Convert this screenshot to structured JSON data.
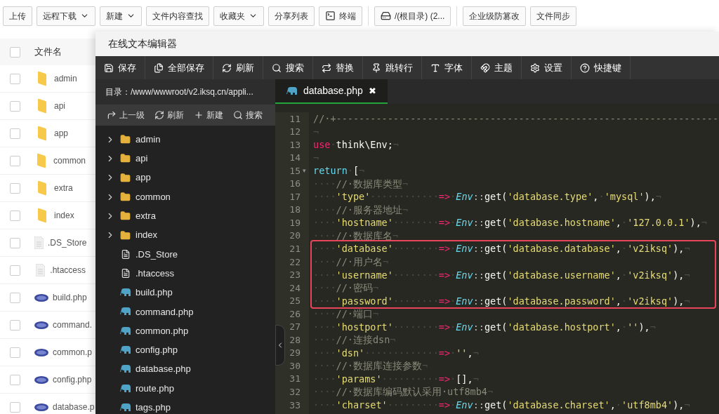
{
  "toolbar": [
    {
      "label": "上传",
      "kind": "plain"
    },
    {
      "label": "远程下载",
      "kind": "dropdown"
    },
    {
      "label": "新建",
      "kind": "dropdown"
    },
    {
      "label": "文件内容查找",
      "kind": "plain"
    },
    {
      "label": "收藏夹",
      "kind": "dropdown"
    },
    {
      "label": "分享列表",
      "kind": "plain"
    },
    {
      "label": "终端",
      "kind": "terminal"
    },
    {
      "label": "/(根目录) (2...",
      "kind": "drive"
    },
    {
      "label": "企业级防篡改",
      "kind": "plain"
    },
    {
      "label": "文件同步",
      "kind": "plain"
    }
  ],
  "file_list": {
    "header": "文件名",
    "header_checked": false,
    "rows": [
      {
        "name": "admin",
        "kind": "folder",
        "checked": false
      },
      {
        "name": "api",
        "kind": "folder",
        "checked": false
      },
      {
        "name": "app",
        "kind": "folder",
        "checked": false
      },
      {
        "name": "common",
        "kind": "folder",
        "checked": false
      },
      {
        "name": "extra",
        "kind": "folder",
        "checked": false
      },
      {
        "name": "index",
        "kind": "folder",
        "checked": false
      },
      {
        "name": ".DS_Store",
        "kind": "file",
        "checked": false
      },
      {
        "name": ".htaccess",
        "kind": "file",
        "checked": false
      },
      {
        "name": "build.php",
        "kind": "php",
        "checked": false
      },
      {
        "name": "command.",
        "kind": "php",
        "checked": false
      },
      {
        "name": "common.p",
        "kind": "php",
        "checked": false
      },
      {
        "name": "config.php",
        "kind": "php",
        "checked": false
      },
      {
        "name": "database.p",
        "kind": "php",
        "checked": false
      }
    ]
  },
  "editor": {
    "title": "在线文本编辑器",
    "toolbar": [
      {
        "label": "保存"
      },
      {
        "label": "全部保存"
      },
      {
        "label": "刷新"
      },
      {
        "label": "搜索"
      },
      {
        "label": "替换"
      },
      {
        "label": "跳转行"
      },
      {
        "label": "字体"
      },
      {
        "label": "主题"
      },
      {
        "label": "设置"
      },
      {
        "label": "快捷键"
      }
    ],
    "path": "目录：/www/wwwroot/v2.iksq.cn/appli...",
    "actions": [
      {
        "label": "上一级"
      },
      {
        "label": "刷新"
      },
      {
        "label": "新建"
      },
      {
        "label": "搜索"
      }
    ],
    "tree": [
      {
        "name": "admin",
        "kind": "folder",
        "expanded": false
      },
      {
        "name": "api",
        "kind": "folder",
        "expanded": false
      },
      {
        "name": "app",
        "kind": "folder",
        "expanded": false
      },
      {
        "name": "common",
        "kind": "folder",
        "expanded": false
      },
      {
        "name": "extra",
        "kind": "folder",
        "expanded": false
      },
      {
        "name": "index",
        "kind": "folder",
        "expanded": false
      },
      {
        "name": ".DS_Store",
        "kind": "file"
      },
      {
        "name": ".htaccess",
        "kind": "file"
      },
      {
        "name": "build.php",
        "kind": "php"
      },
      {
        "name": "command.php",
        "kind": "php"
      },
      {
        "name": "common.php",
        "kind": "php"
      },
      {
        "name": "config.php",
        "kind": "php"
      },
      {
        "name": "database.php",
        "kind": "php"
      },
      {
        "name": "route.php",
        "kind": "php"
      },
      {
        "name": "tags.php",
        "kind": "php"
      }
    ],
    "tabs": [
      {
        "label": "database.php",
        "selected": true,
        "close": "✖"
      }
    ],
    "code": [
      {
        "num": "11",
        "tokens": [
          {
            "kind": "comment",
            "text": "//·+-------------------------------------------------------------------"
          }
        ]
      },
      {
        "num": "12",
        "tokens": [
          {
            "kind": "eol",
            "text": "¬"
          }
        ]
      },
      {
        "num": "13",
        "tokens": [
          {
            "kind": "kw",
            "text": "use"
          },
          {
            "kind": "ws",
            "text": "·"
          },
          {
            "kind": "plain",
            "text": "think\\Env;"
          },
          {
            "kind": "eol",
            "text": "¬"
          }
        ]
      },
      {
        "num": "14",
        "tokens": [
          {
            "kind": "eol",
            "text": "¬"
          }
        ]
      },
      {
        "num": "15",
        "fold": "▾",
        "tokens": [
          {
            "kind": "kw2",
            "text": "return"
          },
          {
            "kind": "ws",
            "text": "·"
          },
          {
            "kind": "plain",
            "text": "["
          },
          {
            "kind": "eol",
            "text": "¬"
          }
        ]
      },
      {
        "num": "16",
        "tokens": [
          {
            "kind": "ws",
            "text": "····"
          },
          {
            "kind": "comment",
            "text": "//·数据库类型"
          },
          {
            "kind": "eol",
            "text": "¬"
          }
        ]
      },
      {
        "num": "17",
        "tokens": [
          {
            "kind": "ws",
            "text": "····"
          },
          {
            "kind": "str",
            "text": "'type'"
          },
          {
            "kind": "ws",
            "text": "············"
          },
          {
            "kind": "op",
            "text": "=>"
          },
          {
            "kind": "ws",
            "text": "·"
          },
          {
            "kind": "cls",
            "text": "Env"
          },
          {
            "kind": "punct",
            "text": "::"
          },
          {
            "kind": "plain",
            "text": "get("
          },
          {
            "kind": "str",
            "text": "'database.type'"
          },
          {
            "kind": "plain",
            "text": ","
          },
          {
            "kind": "ws",
            "text": "·"
          },
          {
            "kind": "str",
            "text": "'mysql'"
          },
          {
            "kind": "plain",
            "text": "),"
          },
          {
            "kind": "eol",
            "text": "¬"
          }
        ]
      },
      {
        "num": "18",
        "tokens": [
          {
            "kind": "ws",
            "text": "····"
          },
          {
            "kind": "comment",
            "text": "//·服务器地址"
          },
          {
            "kind": "eol",
            "text": "¬"
          }
        ]
      },
      {
        "num": "19",
        "tokens": [
          {
            "kind": "ws",
            "text": "····"
          },
          {
            "kind": "str",
            "text": "'hostname'"
          },
          {
            "kind": "ws",
            "text": "········"
          },
          {
            "kind": "op",
            "text": "=>"
          },
          {
            "kind": "ws",
            "text": "·"
          },
          {
            "kind": "cls",
            "text": "Env"
          },
          {
            "kind": "punct",
            "text": "::"
          },
          {
            "kind": "plain",
            "text": "get("
          },
          {
            "kind": "str",
            "text": "'database.hostname'"
          },
          {
            "kind": "plain",
            "text": ","
          },
          {
            "kind": "ws",
            "text": "·"
          },
          {
            "kind": "str",
            "text": "'127.0.0.1'"
          },
          {
            "kind": "plain",
            "text": "),"
          },
          {
            "kind": "eol",
            "text": "¬"
          }
        ]
      },
      {
        "num": "20",
        "tokens": [
          {
            "kind": "ws",
            "text": "····"
          },
          {
            "kind": "comment",
            "text": "//·数据库名"
          },
          {
            "kind": "eol",
            "text": "¬"
          }
        ]
      },
      {
        "num": "21",
        "tokens": [
          {
            "kind": "ws",
            "text": "····"
          },
          {
            "kind": "str",
            "text": "'database'"
          },
          {
            "kind": "ws",
            "text": "········"
          },
          {
            "kind": "op",
            "text": "=>"
          },
          {
            "kind": "ws",
            "text": "·"
          },
          {
            "kind": "cls",
            "text": "Env"
          },
          {
            "kind": "punct",
            "text": "::"
          },
          {
            "kind": "plain",
            "text": "get("
          },
          {
            "kind": "str",
            "text": "'database.database'"
          },
          {
            "kind": "plain",
            "text": ","
          },
          {
            "kind": "ws",
            "text": "·"
          },
          {
            "kind": "str",
            "text": "'v2iksq'"
          },
          {
            "kind": "plain",
            "text": "),"
          },
          {
            "kind": "eol",
            "text": "¬"
          }
        ]
      },
      {
        "num": "22",
        "tokens": [
          {
            "kind": "ws",
            "text": "····"
          },
          {
            "kind": "comment",
            "text": "//·用户名"
          },
          {
            "kind": "eol",
            "text": "¬"
          }
        ]
      },
      {
        "num": "23",
        "tokens": [
          {
            "kind": "ws",
            "text": "····"
          },
          {
            "kind": "str",
            "text": "'username'"
          },
          {
            "kind": "ws",
            "text": "········"
          },
          {
            "kind": "op",
            "text": "=>"
          },
          {
            "kind": "ws",
            "text": "·"
          },
          {
            "kind": "cls",
            "text": "Env"
          },
          {
            "kind": "punct",
            "text": "::"
          },
          {
            "kind": "plain",
            "text": "get("
          },
          {
            "kind": "str",
            "text": "'database.username'"
          },
          {
            "kind": "plain",
            "text": ","
          },
          {
            "kind": "ws",
            "text": "·"
          },
          {
            "kind": "str",
            "text": "'v2iksq'"
          },
          {
            "kind": "plain",
            "text": "),"
          },
          {
            "kind": "eol",
            "text": "¬"
          }
        ]
      },
      {
        "num": "24",
        "tokens": [
          {
            "kind": "ws",
            "text": "····"
          },
          {
            "kind": "comment",
            "text": "//·密码"
          },
          {
            "kind": "eol",
            "text": "¬"
          }
        ]
      },
      {
        "num": "25",
        "tokens": [
          {
            "kind": "ws",
            "text": "····"
          },
          {
            "kind": "str",
            "text": "'password'"
          },
          {
            "kind": "ws",
            "text": "········"
          },
          {
            "kind": "op",
            "text": "=>"
          },
          {
            "kind": "ws",
            "text": "·"
          },
          {
            "kind": "cls",
            "text": "Env"
          },
          {
            "kind": "punct",
            "text": "::"
          },
          {
            "kind": "plain",
            "text": "get("
          },
          {
            "kind": "str",
            "text": "'database.password'"
          },
          {
            "kind": "plain",
            "text": ","
          },
          {
            "kind": "ws",
            "text": "·"
          },
          {
            "kind": "str",
            "text": "'v2iksq'"
          },
          {
            "kind": "plain",
            "text": "),"
          },
          {
            "kind": "eol",
            "text": "¬"
          }
        ]
      },
      {
        "num": "26",
        "tokens": [
          {
            "kind": "ws",
            "text": "····"
          },
          {
            "kind": "comment",
            "text": "//·端口"
          },
          {
            "kind": "eol",
            "text": "¬"
          }
        ]
      },
      {
        "num": "27",
        "tokens": [
          {
            "kind": "ws",
            "text": "····"
          },
          {
            "kind": "str",
            "text": "'hostport'"
          },
          {
            "kind": "ws",
            "text": "········"
          },
          {
            "kind": "op",
            "text": "=>"
          },
          {
            "kind": "ws",
            "text": "·"
          },
          {
            "kind": "cls",
            "text": "Env"
          },
          {
            "kind": "punct",
            "text": "::"
          },
          {
            "kind": "plain",
            "text": "get("
          },
          {
            "kind": "str",
            "text": "'database.hostport'"
          },
          {
            "kind": "plain",
            "text": ","
          },
          {
            "kind": "ws",
            "text": "·"
          },
          {
            "kind": "str",
            "text": "''"
          },
          {
            "kind": "plain",
            "text": "),"
          },
          {
            "kind": "eol",
            "text": "¬"
          }
        ]
      },
      {
        "num": "28",
        "tokens": [
          {
            "kind": "ws",
            "text": "····"
          },
          {
            "kind": "comment",
            "text": "//·连接dsn"
          },
          {
            "kind": "eol",
            "text": "¬"
          }
        ]
      },
      {
        "num": "29",
        "tokens": [
          {
            "kind": "ws",
            "text": "····"
          },
          {
            "kind": "str",
            "text": "'dsn'"
          },
          {
            "kind": "ws",
            "text": "·············"
          },
          {
            "kind": "op",
            "text": "=>"
          },
          {
            "kind": "ws",
            "text": "·"
          },
          {
            "kind": "str",
            "text": "''"
          },
          {
            "kind": "plain",
            "text": ","
          },
          {
            "kind": "eol",
            "text": "¬"
          }
        ]
      },
      {
        "num": "30",
        "tokens": [
          {
            "kind": "ws",
            "text": "····"
          },
          {
            "kind": "comment",
            "text": "//·数据库连接参数"
          },
          {
            "kind": "eol",
            "text": "¬"
          }
        ]
      },
      {
        "num": "31",
        "tokens": [
          {
            "kind": "ws",
            "text": "····"
          },
          {
            "kind": "str",
            "text": "'params'"
          },
          {
            "kind": "ws",
            "text": "··········"
          },
          {
            "kind": "op",
            "text": "=>"
          },
          {
            "kind": "ws",
            "text": "·"
          },
          {
            "kind": "plain",
            "text": "[],"
          },
          {
            "kind": "eol",
            "text": "¬"
          }
        ]
      },
      {
        "num": "32",
        "tokens": [
          {
            "kind": "ws",
            "text": "····"
          },
          {
            "kind": "comment",
            "text": "//·数据库编码默认采用·utf8mb4"
          },
          {
            "kind": "eol",
            "text": "¬"
          }
        ]
      },
      {
        "num": "33",
        "tokens": [
          {
            "kind": "ws",
            "text": "····"
          },
          {
            "kind": "str",
            "text": "'charset'"
          },
          {
            "kind": "ws",
            "text": "·········"
          },
          {
            "kind": "op",
            "text": "=>"
          },
          {
            "kind": "ws",
            "text": "·"
          },
          {
            "kind": "cls",
            "text": "Env"
          },
          {
            "kind": "punct",
            "text": "::"
          },
          {
            "kind": "plain",
            "text": "get("
          },
          {
            "kind": "str",
            "text": "'database.charset'"
          },
          {
            "kind": "plain",
            "text": ","
          },
          {
            "kind": "ws",
            "text": "·"
          },
          {
            "kind": "str",
            "text": "'utf8mb4'"
          },
          {
            "kind": "plain",
            "text": "),"
          },
          {
            "kind": "eol",
            "text": "¬"
          }
        ]
      }
    ]
  }
}
